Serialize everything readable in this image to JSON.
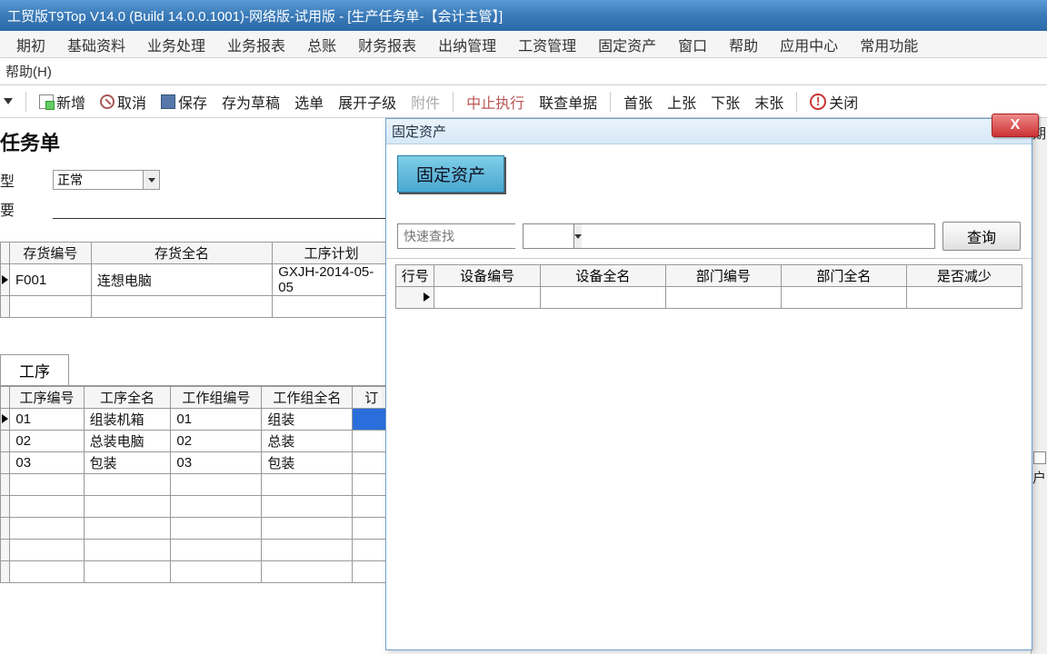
{
  "titlebar": "工贸版T9Top V14.0 (Build 14.0.0.1001)-网络版-试用版 - [生产任务单-【会计主管】]",
  "menu": [
    "期初",
    "基础资料",
    "业务处理",
    "业务报表",
    "总账",
    "财务报表",
    "出纳管理",
    "工资管理",
    "固定资产",
    "窗口",
    "帮助",
    "应用中心",
    "常用功能"
  ],
  "help_row": "帮助(H)",
  "toolbar": {
    "new": "新增",
    "cancel": "取消",
    "save": "保存",
    "draft": "存为草稿",
    "select": "选单",
    "expand": "展开子级",
    "attach": "附件",
    "abort": "中止执行",
    "linkquery": "联查单据",
    "first": "首张",
    "prev": "上张",
    "next": "下张",
    "last": "末张",
    "close": "关闭"
  },
  "page_title": "任务单",
  "form": {
    "type_label": "型",
    "type_value": "正常",
    "summary_label": "要"
  },
  "right_chars": {
    "top": "期",
    "mid": "户"
  },
  "upper_grid": {
    "cols": [
      "存货编号",
      "存货全名",
      "工序计划"
    ],
    "rows": [
      {
        "code": "F001",
        "name": "连想电脑",
        "plan": "GXJH-2014-05-05"
      }
    ]
  },
  "tab_label": "工序",
  "lower_grid": {
    "cols": [
      "工序编号",
      "工序全名",
      "工作组编号",
      "工作组全名"
    ],
    "last_col_frag": "订",
    "rows": [
      {
        "c1": "01",
        "c2": "组装机箱",
        "c3": "01",
        "c4": "组装"
      },
      {
        "c1": "02",
        "c2": "总装电脑",
        "c3": "02",
        "c4": "总装"
      },
      {
        "c1": "03",
        "c2": "包装",
        "c3": "03",
        "c4": "包装"
      }
    ]
  },
  "dialog": {
    "title": "固定资产",
    "bigbtn": "固定资产",
    "quickfind_placeholder": "快速查找",
    "query_btn": "查询",
    "cols": [
      "行号",
      "设备编号",
      "设备全名",
      "部门编号",
      "部门全名",
      "是否减少"
    ],
    "close_x": "X"
  }
}
